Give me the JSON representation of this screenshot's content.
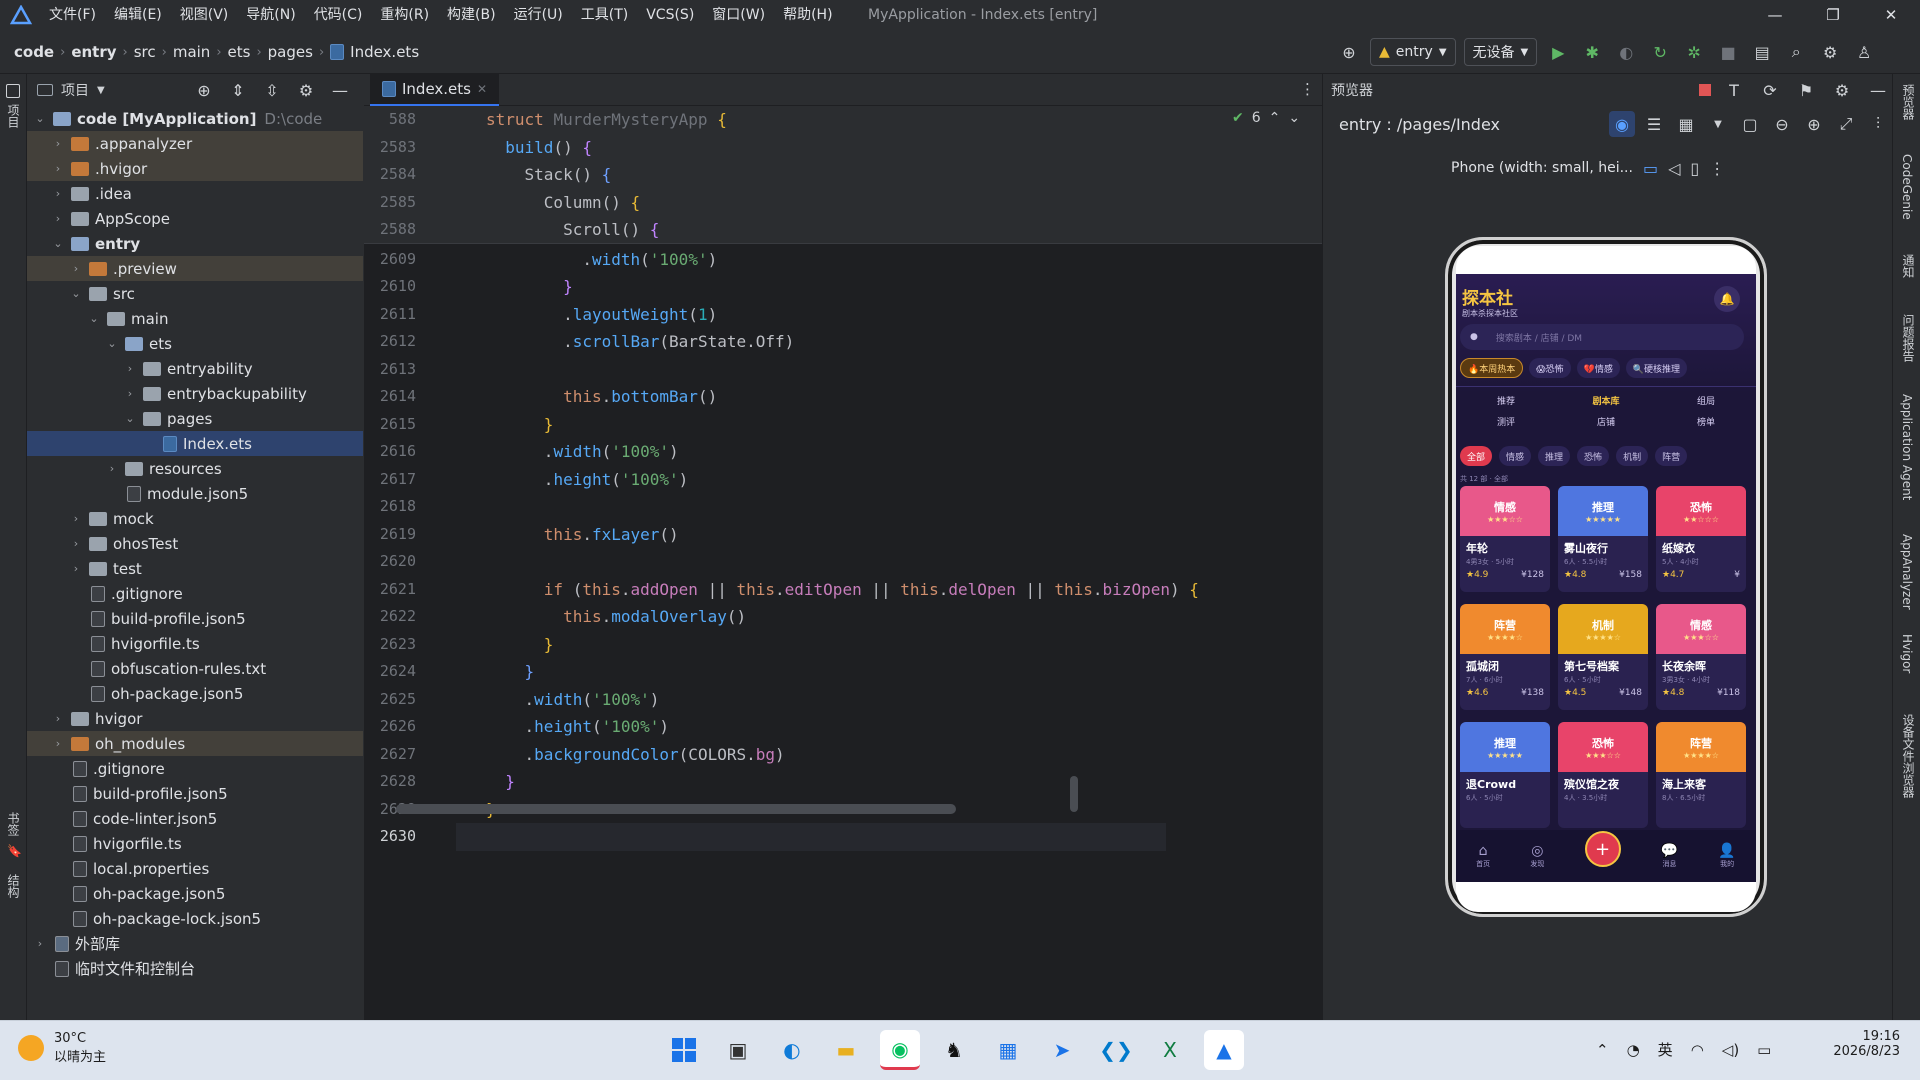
{
  "titlebar": {
    "menu": [
      "文件(F)",
      "编辑(E)",
      "视图(V)",
      "导航(N)",
      "代码(C)",
      "重构(R)",
      "构建(B)",
      "运行(U)",
      "工具(T)",
      "VCS(S)",
      "窗口(W)",
      "帮助(H)"
    ],
    "window_title": "MyApplication - Index.ets [entry]"
  },
  "navbar": {
    "breadcrumbs": [
      "code",
      "entry",
      "src",
      "main",
      "ets",
      "pages",
      "Index.ets"
    ],
    "run_config": "entry",
    "device": "无设备"
  },
  "leftstrip": {
    "project_label": "项目",
    "bookmarks_label": "书签",
    "structure_label": "结构"
  },
  "project": {
    "header_label": "项目",
    "tree": [
      {
        "depth": 0,
        "arrow": "v",
        "icon": "folder-blue",
        "label": "code [MyApplication]",
        "extra": "D:\\code",
        "bold": true,
        "state": ""
      },
      {
        "depth": 1,
        "arrow": ">",
        "icon": "folder-orange",
        "label": ".appanalyzer",
        "state": "hl"
      },
      {
        "depth": 1,
        "arrow": ">",
        "icon": "folder-orange",
        "label": ".hvigor",
        "state": "hl"
      },
      {
        "depth": 1,
        "arrow": ">",
        "icon": "folder-gray",
        "label": ".idea",
        "state": ""
      },
      {
        "depth": 1,
        "arrow": ">",
        "icon": "folder-gray",
        "label": "AppScope",
        "state": ""
      },
      {
        "depth": 1,
        "arrow": "v",
        "icon": "folder-blue",
        "label": "entry",
        "bold": true,
        "state": ""
      },
      {
        "depth": 2,
        "arrow": ">",
        "icon": "folder-orange",
        "label": ".preview",
        "state": "hl"
      },
      {
        "depth": 2,
        "arrow": "v",
        "icon": "folder-gray",
        "label": "src",
        "state": ""
      },
      {
        "depth": 3,
        "arrow": "v",
        "icon": "folder-gray",
        "label": "main",
        "state": ""
      },
      {
        "depth": 4,
        "arrow": "v",
        "icon": "folder-blue",
        "label": "ets",
        "state": ""
      },
      {
        "depth": 5,
        "arrow": ">",
        "icon": "folder-gray",
        "label": "entryability",
        "state": ""
      },
      {
        "depth": 5,
        "arrow": ">",
        "icon": "folder-gray",
        "label": "entrybackupability",
        "state": ""
      },
      {
        "depth": 5,
        "arrow": "v",
        "icon": "folder-gray",
        "label": "pages",
        "state": ""
      },
      {
        "depth": 6,
        "arrow": "",
        "icon": "file-ets",
        "label": "Index.ets",
        "state": "sel"
      },
      {
        "depth": 4,
        "arrow": ">",
        "icon": "folder-gray",
        "label": "resources",
        "state": ""
      },
      {
        "depth": 4,
        "arrow": "",
        "icon": "file",
        "label": "module.json5",
        "state": ""
      },
      {
        "depth": 2,
        "arrow": ">",
        "icon": "folder-gray",
        "label": "mock",
        "state": ""
      },
      {
        "depth": 2,
        "arrow": ">",
        "icon": "folder-gray",
        "label": "ohosTest",
        "state": ""
      },
      {
        "depth": 2,
        "arrow": ">",
        "icon": "folder-gray",
        "label": "test",
        "state": ""
      },
      {
        "depth": 2,
        "arrow": "",
        "icon": "file",
        "label": ".gitignore",
        "state": ""
      },
      {
        "depth": 2,
        "arrow": "",
        "icon": "file",
        "label": "build-profile.json5",
        "state": ""
      },
      {
        "depth": 2,
        "arrow": "",
        "icon": "file",
        "label": "hvigorfile.ts",
        "state": ""
      },
      {
        "depth": 2,
        "arrow": "",
        "icon": "file",
        "label": "obfuscation-rules.txt",
        "state": ""
      },
      {
        "depth": 2,
        "arrow": "",
        "icon": "file",
        "label": "oh-package.json5",
        "state": ""
      },
      {
        "depth": 1,
        "arrow": ">",
        "icon": "folder-gray",
        "label": "hvigor",
        "state": ""
      },
      {
        "depth": 1,
        "arrow": ">",
        "icon": "folder-orange",
        "label": "oh_modules",
        "state": "hl"
      },
      {
        "depth": 1,
        "arrow": "",
        "icon": "file",
        "label": ".gitignore",
        "state": ""
      },
      {
        "depth": 1,
        "arrow": "",
        "icon": "file",
        "label": "build-profile.json5",
        "state": ""
      },
      {
        "depth": 1,
        "arrow": "",
        "icon": "file",
        "label": "code-linter.json5",
        "state": ""
      },
      {
        "depth": 1,
        "arrow": "",
        "icon": "file",
        "label": "hvigorfile.ts",
        "state": ""
      },
      {
        "depth": 1,
        "arrow": "",
        "icon": "file",
        "label": "local.properties",
        "state": ""
      },
      {
        "depth": 1,
        "arrow": "",
        "icon": "file",
        "label": "oh-package.json5",
        "state": ""
      },
      {
        "depth": 1,
        "arrow": "",
        "icon": "file",
        "label": "oh-package-lock.json5",
        "state": ""
      },
      {
        "depth": 0,
        "arrow": ">",
        "icon": "lib",
        "label": "外部库",
        "state": ""
      },
      {
        "depth": 0,
        "arrow": "",
        "icon": "scratch",
        "label": "临时文件和控制台",
        "state": ""
      }
    ]
  },
  "editor": {
    "tab_label": "Index.ets",
    "problems_count": "6",
    "sticky_lines": [
      "588",
      "2583",
      "2584",
      "2585",
      "2588"
    ],
    "lines": [
      "2609",
      "2610",
      "2611",
      "2612",
      "2613",
      "2614",
      "2615",
      "2616",
      "2617",
      "2618",
      "2619",
      "2620",
      "2621",
      "2622",
      "2623",
      "2624",
      "2625",
      "2626",
      "2627",
      "2628",
      "2629",
      "2630"
    ]
  },
  "preview": {
    "panel_title": "预览器",
    "route": "entry : /pages/Index",
    "device_label": "Phone (width: small, hei...",
    "app": {
      "title": "探本社",
      "subtitle": "剧本杀探本社区",
      "search_placeholder": "搜索剧本 / 店铺 / DM",
      "chips": [
        "🔥本周热本",
        "😱恐怖",
        "💔情感",
        "🔍硬核推理"
      ],
      "tabs_row1": [
        "推荐",
        "剧本库",
        "组局"
      ],
      "tabs_row2": [
        "测评",
        "店铺",
        "榜单"
      ],
      "filters": [
        "全部",
        "情感",
        "推理",
        "恐怖",
        "机制",
        "阵营"
      ],
      "count_text": "共 12 部 · 全部",
      "cards": [
        {
          "genre": "情感",
          "stars": "★★★☆☆",
          "title": "年轮",
          "sub": "4男3女 · 5小时",
          "rating": "★4.9",
          "price": "¥128",
          "color": "#e8588a"
        },
        {
          "genre": "推理",
          "stars": "★★★★★",
          "title": "雾山夜行",
          "sub": "6人 · 5.5小时",
          "rating": "★4.8",
          "price": "¥158",
          "color": "#4f76e0"
        },
        {
          "genre": "恐怖",
          "stars": "★★☆☆☆",
          "title": "纸嫁衣",
          "sub": "5人 · 4小时",
          "rating": "★4.7",
          "price": "¥",
          "color": "#e8446a"
        },
        {
          "genre": "阵营",
          "stars": "★★★★☆",
          "title": "孤城闭",
          "sub": "7人 · 6小时",
          "rating": "★4.6",
          "price": "¥138",
          "color": "#f08a2e"
        },
        {
          "genre": "机制",
          "stars": "★★★★☆",
          "title": "第七号档案",
          "sub": "6人 · 5小时",
          "rating": "★4.5",
          "price": "¥148",
          "color": "#e6a81e"
        },
        {
          "genre": "情感",
          "stars": "★★★☆☆",
          "title": "长夜余晖",
          "sub": "3男3女 · 4小时",
          "rating": "★4.8",
          "price": "¥118",
          "color": "#e8588a"
        },
        {
          "genre": "推理",
          "stars": "★★★★★",
          "title": "退Crowd",
          "sub": "6人 · 5小时",
          "rating": "",
          "price": "",
          "color": "#4f76e0"
        },
        {
          "genre": "恐怖",
          "stars": "★★★☆☆",
          "title": "殡仪馆之夜",
          "sub": "4人 · 3.5小时",
          "rating": "",
          "price": "",
          "color": "#e8446a"
        },
        {
          "genre": "阵营",
          "stars": "★★★★☆",
          "title": "海上来客",
          "sub": "8人 · 6.5小时",
          "rating": "",
          "price": "",
          "color": "#f08a2e"
        }
      ],
      "bottom_nav": [
        "首页",
        "发现",
        "",
        "消息",
        "我的"
      ]
    }
  },
  "rightstrip": [
    "预览器",
    "CodeGenie",
    "通知",
    "问题报告",
    "Application Agent",
    "AppAnalyzer",
    "Hvigor",
    "设备文件浏览器"
  ],
  "taskbar": {
    "weather_temp": "30°C",
    "weather_text": "以晴为主",
    "ime": "英",
    "time": "19:16",
    "date": "2026/8/23"
  },
  "colors": {
    "accent": "#3574f0",
    "editor_bg": "#1e1f22",
    "panel_bg": "#2b2d30",
    "app_bg": "#1c1638",
    "app_gold": "#f5c542"
  }
}
